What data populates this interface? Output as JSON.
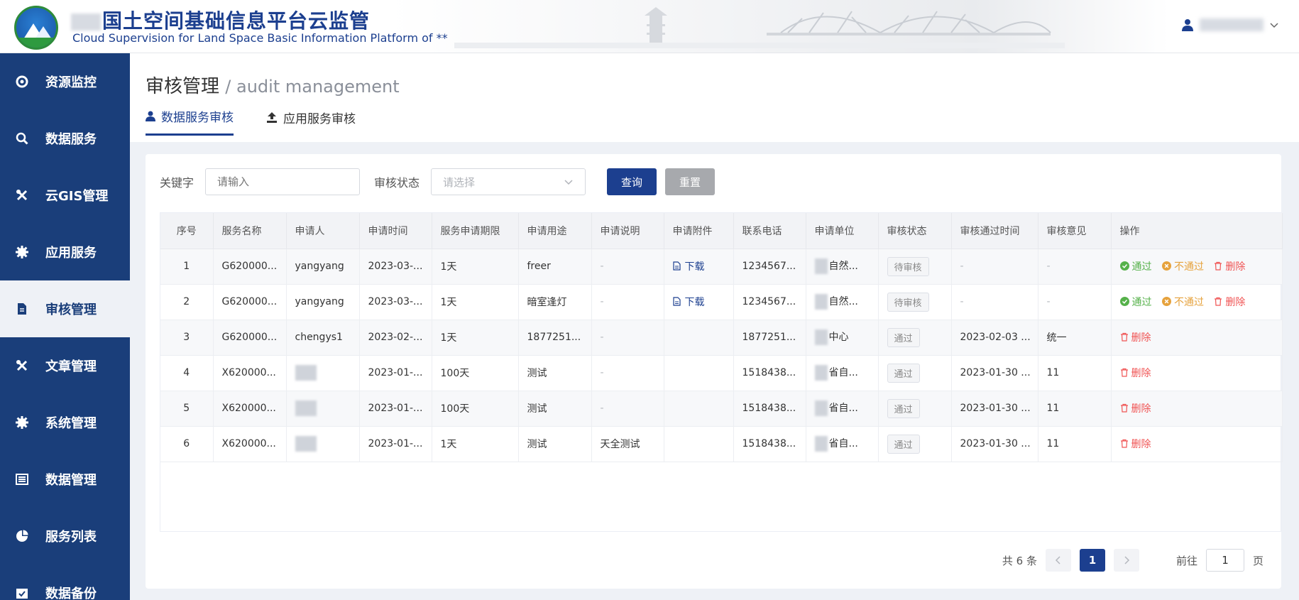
{
  "header": {
    "title_cn": "国土空间基础信息平台云监管",
    "title_en": "Cloud Supervision for Land Space Basic Information Platform of **"
  },
  "sidebar": {
    "items": [
      {
        "label": "资源监控",
        "icon": "lifebuoy-icon"
      },
      {
        "label": "数据服务",
        "icon": "search-icon"
      },
      {
        "label": "云GIS管理",
        "icon": "tools-icon"
      },
      {
        "label": "应用服务",
        "icon": "gear-icon"
      },
      {
        "label": "审核管理",
        "icon": "document-icon",
        "active": true
      },
      {
        "label": "文章管理",
        "icon": "tools-icon"
      },
      {
        "label": "系统管理",
        "icon": "gear-icon"
      },
      {
        "label": "数据管理",
        "icon": "list-icon"
      },
      {
        "label": "服务列表",
        "icon": "pie-chart-icon"
      },
      {
        "label": "数据备份",
        "icon": "calendar-check-icon"
      }
    ]
  },
  "page": {
    "title": "审核管理",
    "subtitle": "/ audit management",
    "tabs": [
      {
        "label": "数据服务审核",
        "active": true
      },
      {
        "label": "应用服务审核",
        "active": false
      }
    ]
  },
  "filters": {
    "keyword_label": "关键字",
    "keyword_placeholder": "请输入",
    "status_label": "审核状态",
    "status_placeholder": "请选择",
    "search_btn": "查询",
    "reset_btn": "重置"
  },
  "table": {
    "columns": [
      "序号",
      "服务名称",
      "申请人",
      "申请时间",
      "服务申请期限",
      "申请用途",
      "申请说明",
      "申请附件",
      "联系电话",
      "申请单位",
      "审核状态",
      "审核通过时间",
      "审核意见",
      "操作"
    ],
    "rows": [
      {
        "no": "1",
        "name": "G620000...",
        "applicant": "yangyang",
        "time": "2023-03-...",
        "period": "1天",
        "purpose": "freer",
        "desc": "-",
        "attachment": "下载",
        "phone": "1234567...",
        "unit": "自然...",
        "status": "待审核",
        "pass_time": "-",
        "opinion": "-",
        "actions": [
          "通过",
          "不通过",
          "删除"
        ]
      },
      {
        "no": "2",
        "name": "G620000...",
        "applicant": "yangyang",
        "time": "2023-03-...",
        "period": "1天",
        "purpose": "暗室逢灯",
        "desc": "-",
        "attachment": "下载",
        "phone": "1234567...",
        "unit": "自然...",
        "status": "待审核",
        "pass_time": "-",
        "opinion": "-",
        "actions": [
          "通过",
          "不通过",
          "删除"
        ]
      },
      {
        "no": "3",
        "name": "G620000...",
        "applicant": "chengys1",
        "time": "2023-02-...",
        "period": "1天",
        "purpose": "1877251...",
        "desc": "-",
        "attachment": "",
        "phone": "1877251...",
        "unit": "中心",
        "status": "通过",
        "pass_time": "2023-02-03 ...",
        "opinion": "统一",
        "actions": [
          "删除"
        ]
      },
      {
        "no": "4",
        "name": "X620000...",
        "applicant": "",
        "time": "2023-01-...",
        "period": "100天",
        "purpose": "测试",
        "desc": "-",
        "attachment": "",
        "phone": "1518438...",
        "unit": "省自...",
        "status": "通过",
        "pass_time": "2023-01-30 ...",
        "opinion": "11",
        "actions": [
          "删除"
        ]
      },
      {
        "no": "5",
        "name": "X620000...",
        "applicant": "",
        "time": "2023-01-...",
        "period": "100天",
        "purpose": "测试",
        "desc": "-",
        "attachment": "",
        "phone": "1518438...",
        "unit": "省自...",
        "status": "通过",
        "pass_time": "2023-01-30 ...",
        "opinion": "11",
        "actions": [
          "删除"
        ]
      },
      {
        "no": "6",
        "name": "X620000...",
        "applicant": "",
        "time": "2023-01-...",
        "period": "1天",
        "purpose": "测试",
        "desc": "天全测试",
        "attachment": "",
        "phone": "1518438...",
        "unit": "省自...",
        "status": "通过",
        "pass_time": "2023-01-30 ...",
        "opinion": "11",
        "actions": [
          "删除"
        ]
      }
    ]
  },
  "pagination": {
    "total_text": "共 6 条",
    "current_page": "1",
    "goto_label": "前往",
    "goto_value": "1",
    "page_suffix": "页"
  },
  "colors": {
    "brand": "#1c3f8f",
    "sidebar": "#1a3e7a",
    "pass": "#55b14a",
    "reject": "#e6a23c",
    "delete": "#f05454"
  }
}
